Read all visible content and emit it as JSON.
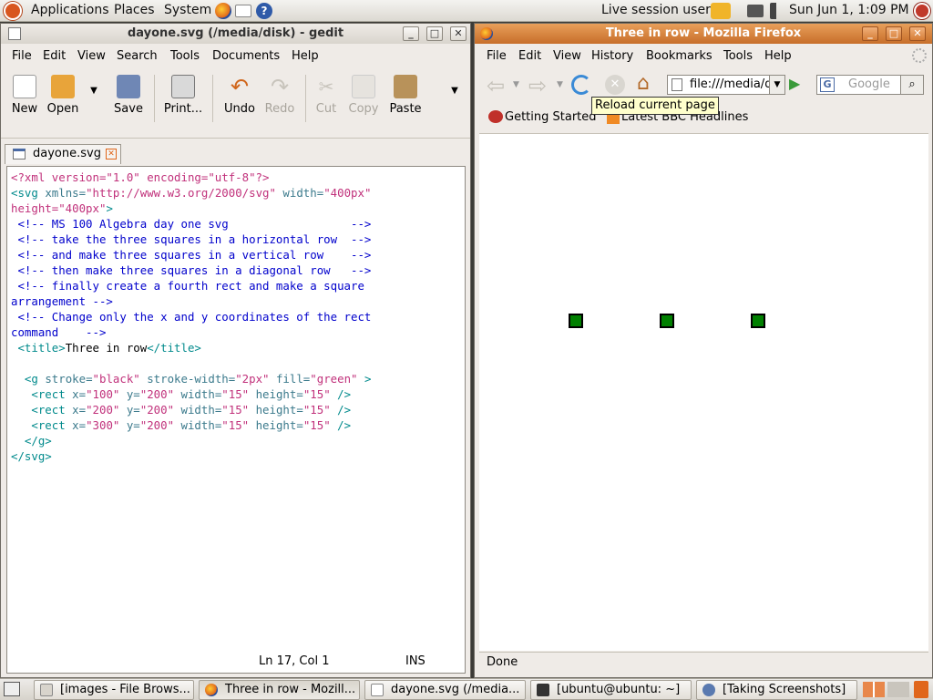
{
  "top_panel": {
    "menus": [
      "Applications",
      "Places",
      "System"
    ],
    "session_user": "Live session user",
    "clock": "Sun Jun  1,  1:09 PM"
  },
  "gedit": {
    "title": "dayone.svg (/media/disk) - gedit",
    "menu": [
      "File",
      "Edit",
      "View",
      "Search",
      "Tools",
      "Documents",
      "Help"
    ],
    "toolbar": [
      "New",
      "Open",
      "Save",
      "Print...",
      "Undo",
      "Redo",
      "Cut",
      "Copy",
      "Paste"
    ],
    "tab_label": "dayone.svg",
    "status_position": "Ln 17, Col 1",
    "status_mode": "INS",
    "code_lines": [
      [
        [
          "c-pi",
          "<?xml version=\"1.0\" encoding=\"utf-8\"?>"
        ]
      ],
      [
        [
          "c-tag",
          "<svg "
        ],
        [
          "c-attr",
          "xmlns="
        ],
        [
          "c-val",
          "\"http://www.w3.org/2000/svg\" "
        ],
        [
          "c-attr",
          "width="
        ],
        [
          "c-val",
          "\"400px\""
        ]
      ],
      [
        [
          "c-val",
          "height=\"400px\""
        ],
        [
          "c-tag",
          ">"
        ]
      ],
      [
        [
          "c-com",
          " <!-- MS 100 Algebra day one svg                  -->"
        ]
      ],
      [
        [
          "c-com",
          " <!-- take the three squares in a horizontal row  -->"
        ]
      ],
      [
        [
          "c-com",
          " <!-- and make three squares in a vertical row    -->"
        ]
      ],
      [
        [
          "c-com",
          " <!-- then make three squares in a diagonal row   -->"
        ]
      ],
      [
        [
          "c-com",
          " <!-- finally create a fourth rect and make a square"
        ]
      ],
      [
        [
          "c-com",
          "arrangement -->"
        ]
      ],
      [
        [
          "c-com",
          " <!-- Change only the x and y coordinates of the rect"
        ]
      ],
      [
        [
          "c-com",
          "command    -->"
        ]
      ],
      [
        [
          "c-tag",
          " <title>"
        ],
        [
          "",
          "Three in row"
        ],
        [
          "c-tag",
          "</title>"
        ]
      ],
      [
        [
          "",
          ""
        ]
      ],
      [
        [
          "c-tag",
          "  <g "
        ],
        [
          "c-attr",
          "stroke="
        ],
        [
          "c-val",
          "\"black\" "
        ],
        [
          "c-attr",
          "stroke-width="
        ],
        [
          "c-val",
          "\"2px\" "
        ],
        [
          "c-attr",
          "fill="
        ],
        [
          "c-val",
          "\"green\" "
        ],
        [
          "c-tag",
          ">"
        ]
      ],
      [
        [
          "c-tag",
          "   <rect "
        ],
        [
          "c-attr",
          "x="
        ],
        [
          "c-val",
          "\"100\" "
        ],
        [
          "c-attr",
          "y="
        ],
        [
          "c-val",
          "\"200\" "
        ],
        [
          "c-attr",
          "width="
        ],
        [
          "c-val",
          "\"15\" "
        ],
        [
          "c-attr",
          "height="
        ],
        [
          "c-val",
          "\"15\" "
        ],
        [
          "c-tag",
          "/>"
        ]
      ],
      [
        [
          "c-tag",
          "   <rect "
        ],
        [
          "c-attr",
          "x="
        ],
        [
          "c-val",
          "\"200\" "
        ],
        [
          "c-attr",
          "y="
        ],
        [
          "c-val",
          "\"200\" "
        ],
        [
          "c-attr",
          "width="
        ],
        [
          "c-val",
          "\"15\" "
        ],
        [
          "c-attr",
          "height="
        ],
        [
          "c-val",
          "\"15\" "
        ],
        [
          "c-tag",
          "/>"
        ]
      ],
      [
        [
          "c-tag",
          "   <rect "
        ],
        [
          "c-attr",
          "x="
        ],
        [
          "c-val",
          "\"300\" "
        ],
        [
          "c-attr",
          "y="
        ],
        [
          "c-val",
          "\"200\" "
        ],
        [
          "c-attr",
          "width="
        ],
        [
          "c-val",
          "\"15\" "
        ],
        [
          "c-attr",
          "height="
        ],
        [
          "c-val",
          "\"15\" "
        ],
        [
          "c-tag",
          "/>"
        ]
      ],
      [
        [
          "c-tag",
          "  </g>"
        ]
      ],
      [
        [
          "c-tag",
          "</svg>"
        ]
      ]
    ]
  },
  "firefox": {
    "title": "Three in row - Mozilla Firefox",
    "menu": [
      "File",
      "Edit",
      "View",
      "History",
      "Bookmarks",
      "Tools",
      "Help"
    ],
    "url": "file:///media/d",
    "search_placeholder": "Google",
    "bookmarks": [
      "Getting Started",
      "Latest BBC Headlines"
    ],
    "tooltip": "Reload current page",
    "status": "Done",
    "fill_color": "#008000",
    "stroke_color": "#000000"
  },
  "taskbar": [
    "[images - File Brows...",
    "Three in row - Mozill...",
    "dayone.svg (/media...",
    "[ubuntu@ubuntu: ~]",
    "[Taking Screenshots]"
  ]
}
